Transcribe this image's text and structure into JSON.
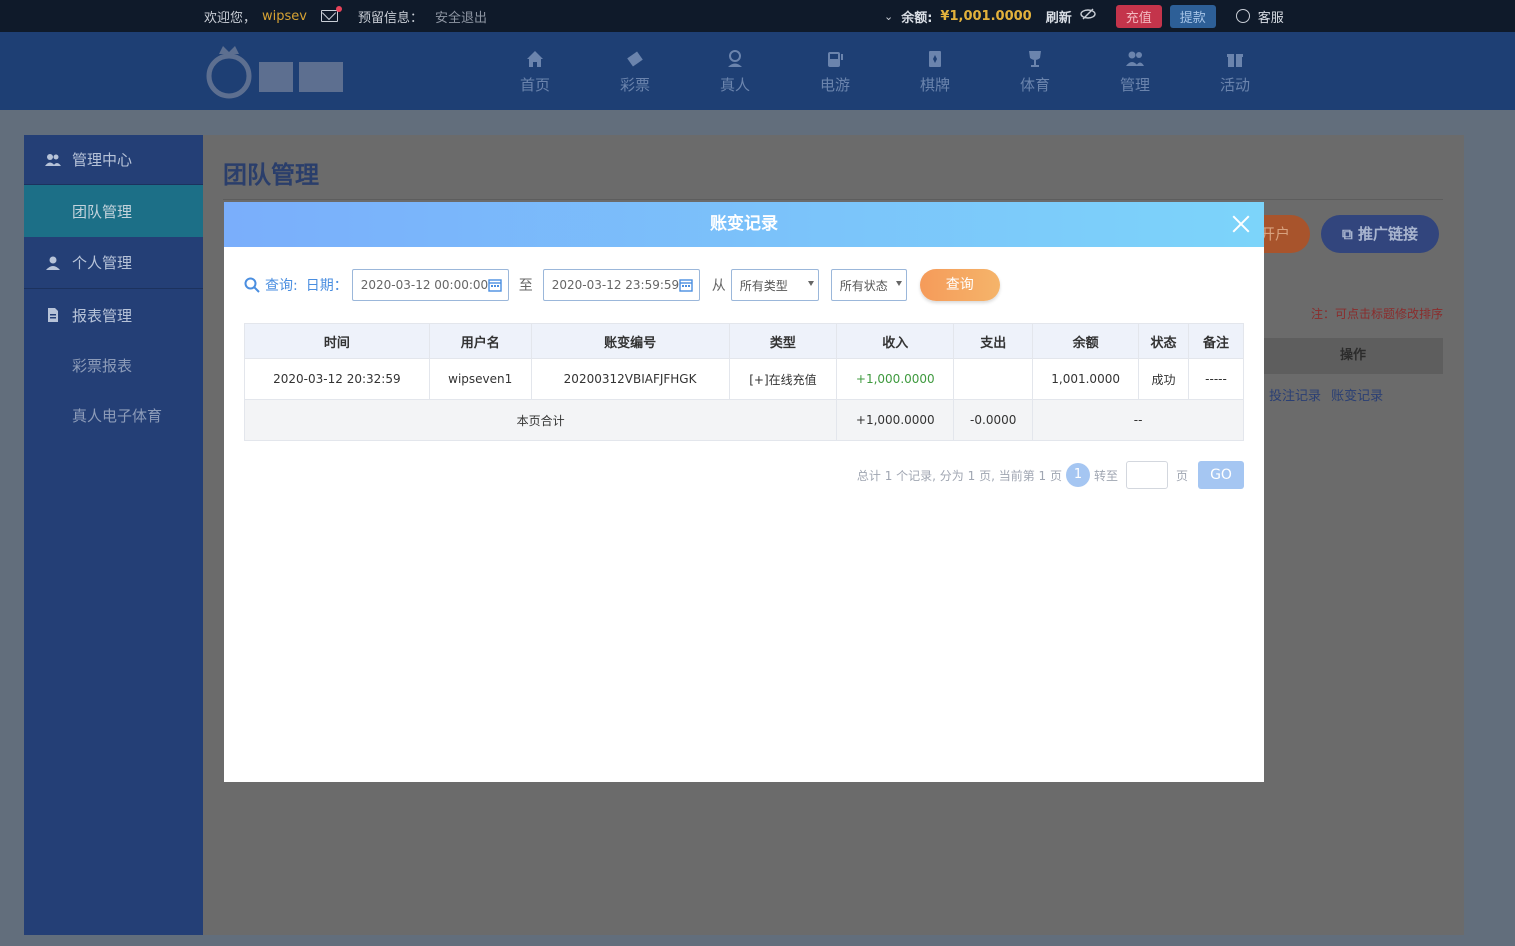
{
  "topbar": {
    "welcome": "欢迎您，",
    "username": "wipsev",
    "reserved_info": "预留信息：",
    "logout": "安全退出",
    "balance_label": "余额:",
    "balance": "¥1,001.0000",
    "refresh": "刷新",
    "recharge": "充值",
    "withdraw": "提款",
    "customer_service": "客服"
  },
  "nav": {
    "items": [
      {
        "label": "首页",
        "icon": "home-icon"
      },
      {
        "label": "彩票",
        "icon": "ticket-icon"
      },
      {
        "label": "真人",
        "icon": "person-icon"
      },
      {
        "label": "电游",
        "icon": "arcade-icon"
      },
      {
        "label": "棋牌",
        "icon": "cards-icon"
      },
      {
        "label": "体育",
        "icon": "trophy-icon"
      },
      {
        "label": "管理",
        "icon": "users-icon"
      },
      {
        "label": "活动",
        "icon": "gift-icon"
      }
    ]
  },
  "sidebar": {
    "management_center": "管理中心",
    "team_management": "团队管理",
    "personal_management": "个人管理",
    "report_management": "报表管理",
    "lottery_report": "彩票报表",
    "live_egames_sports": "真人电子体育"
  },
  "panel": {
    "title": "团队管理",
    "open_account_partial": "开户",
    "promo_link": "推广链接",
    "sort_note": "注：可点击标题修改排序",
    "operation_header": "操作",
    "bet_record_link": "投注记录",
    "account_change_link": "账变记录"
  },
  "modal": {
    "title": "账变记录",
    "query_label": "查询:",
    "date_label": "日期：",
    "date_from": "2020-03-12 00:00:00",
    "to_label": "至",
    "date_to": "2020-03-12 23:59:59",
    "from_label": "从",
    "type_select": "所有类型",
    "status_select": "所有状态",
    "query_button": "查询",
    "columns": [
      "时间",
      "用户名",
      "账变编号",
      "类型",
      "收入",
      "支出",
      "余额",
      "状态",
      "备注"
    ],
    "rows": [
      {
        "time": "2020-03-12 20:32:59",
        "username": "wipseven1",
        "change_no": "20200312VBIAFJFHGK",
        "type": "[+]在线充值",
        "income": "+1,000.0000",
        "expense": "",
        "balance": "1,001.0000",
        "status": "成功",
        "remark": "-----"
      }
    ],
    "total": {
      "label": "本页合计",
      "income": "+1,000.0000",
      "expense": "-0.0000",
      "rest": "--"
    },
    "pager": {
      "summary": "总计 1 个记录, 分为 1 页, 当前第 1 页",
      "current_page": "1",
      "jump_label": "转至",
      "page_label": "页",
      "go": "GO"
    }
  },
  "colors": {
    "modal_header_start": "#7aaefb",
    "modal_header_end": "#7cd4fa",
    "query_button": "#f59b5a",
    "income_green": "#3f9a3f",
    "balance_gold": "#e2b13c"
  }
}
